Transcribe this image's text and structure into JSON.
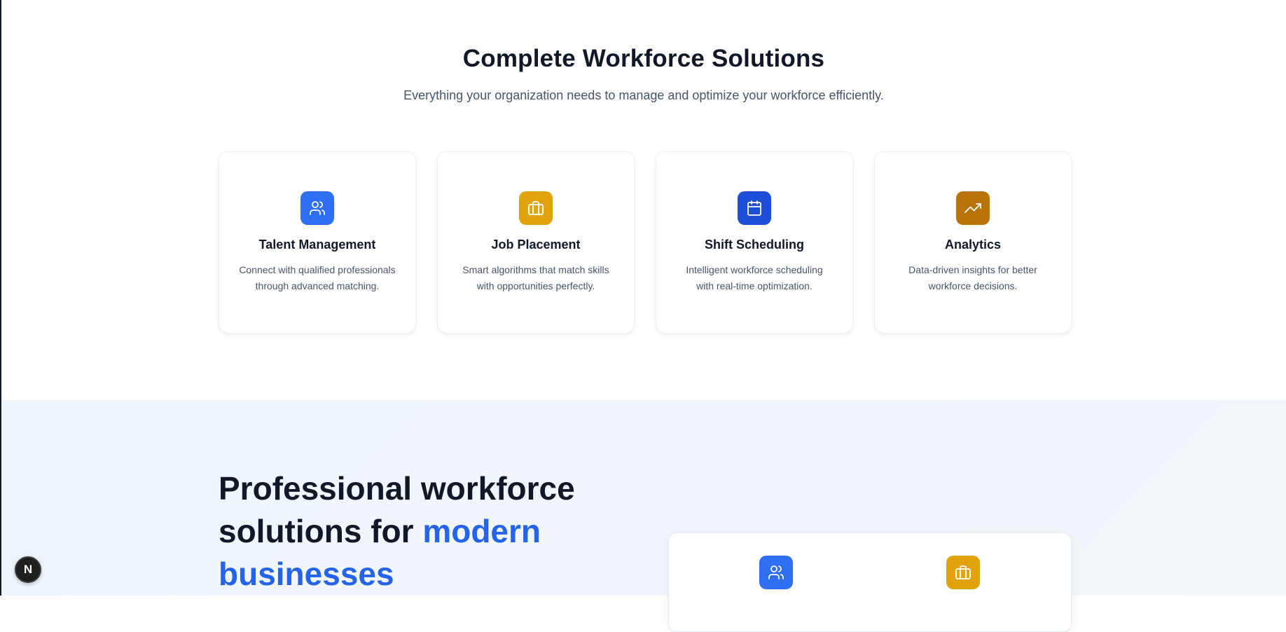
{
  "features": {
    "title": "Complete Workforce Solutions",
    "subtitle": "Everything your organization needs to manage and optimize your workforce efficiently.",
    "cards": [
      {
        "title": "Talent Management",
        "description": "Connect with qualified professionals through advanced matching.",
        "icon": "users-icon",
        "color": "#2f6ff3"
      },
      {
        "title": "Job Placement",
        "description": "Smart algorithms that match skills with opportunities perfectly.",
        "icon": "briefcase-icon",
        "color": "#e1a30c"
      },
      {
        "title": "Shift Scheduling",
        "description": "Intelligent workforce scheduling with real-time optimization.",
        "icon": "calendar-icon",
        "color": "#1d4ed8"
      },
      {
        "title": "Analytics",
        "description": "Data-driven insights for better workforce decisions.",
        "icon": "trending-up-icon",
        "color": "#b8730a"
      }
    ]
  },
  "hero": {
    "heading_line1": "Professional workforce",
    "heading_line2": "solutions for ",
    "heading_accent": "modern businesses",
    "accent_color": "#2563eb",
    "preview_icons": [
      "users-icon",
      "briefcase-icon"
    ]
  },
  "dev_badge": {
    "label": "N"
  }
}
